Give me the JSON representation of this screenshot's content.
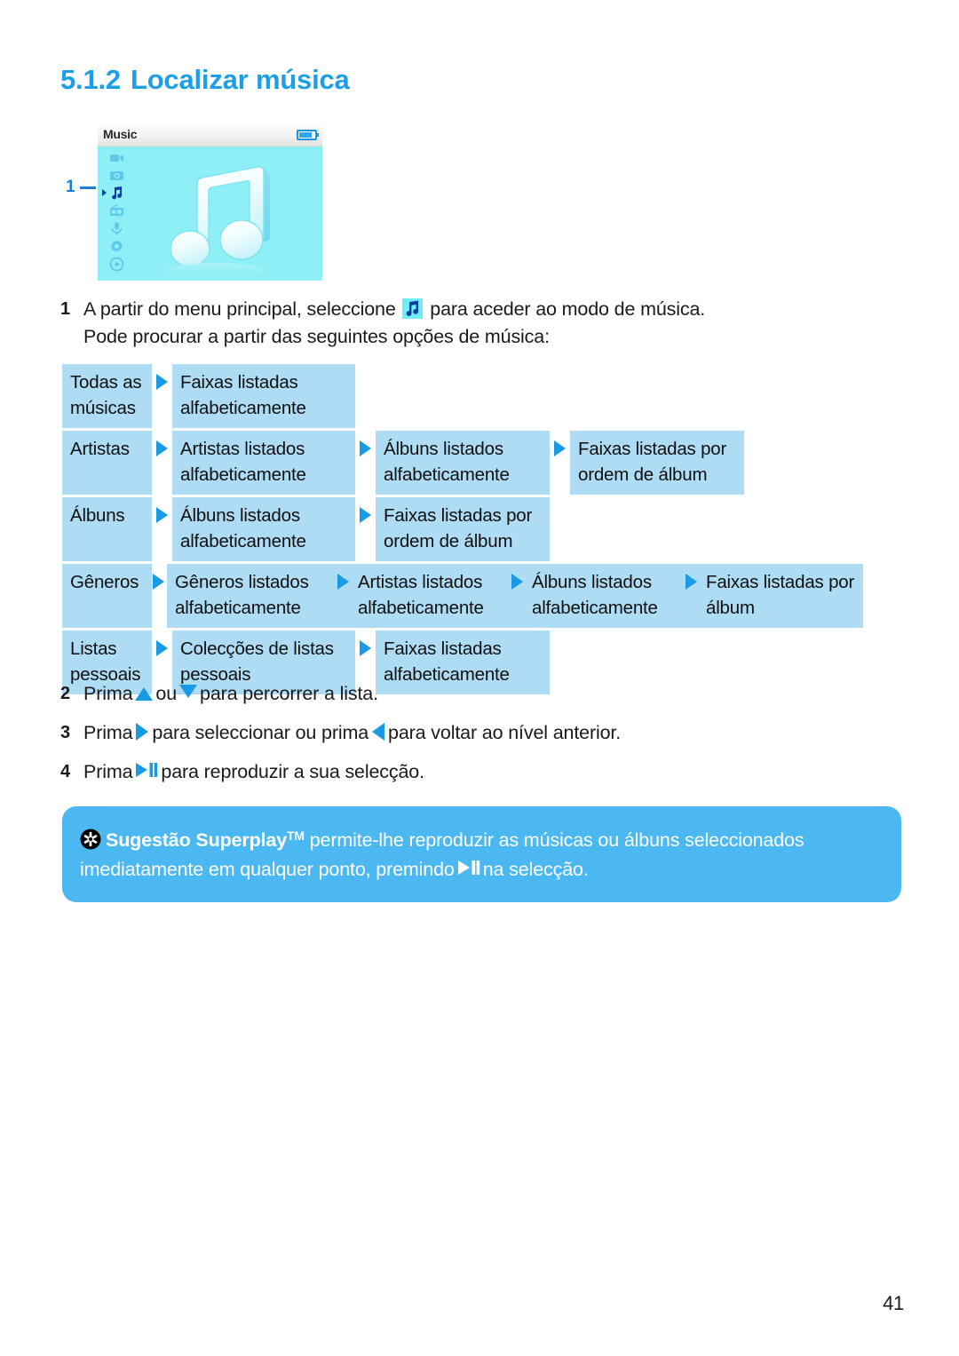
{
  "heading": {
    "number": "5.1.2",
    "title": "Localizar música"
  },
  "device": {
    "title": "Music",
    "battery_icon": "battery-icon",
    "sidebar_icons": [
      "video-camera-icon",
      "photo-camera-icon",
      "music-note-icon",
      "radio-icon",
      "microphone-icon",
      "settings-gear-icon",
      "play-circle-icon"
    ],
    "selected_index": 2,
    "main_icon": "music-note-3d-icon",
    "callout_number": "1"
  },
  "steps": [
    {
      "number": "1",
      "text_before": "A partir do menu principal, seleccione",
      "icon": "music-note-icon",
      "text_after": "para aceder ao modo de música.",
      "line2": "Pode procurar a partir das seguintes opções de música:"
    },
    {
      "number": "2",
      "part1": "Prima",
      "icon1": "arrow-up-icon",
      "part2": "ou",
      "icon2": "arrow-down-icon",
      "part3": "para percorrer a lista."
    },
    {
      "number": "3",
      "part1": "Prima",
      "icon1": "arrow-right-icon",
      "part2": "para seleccionar ou prima",
      "icon2": "arrow-left-icon",
      "part3": "para voltar ao nível anterior."
    },
    {
      "number": "4",
      "part1": "Prima",
      "icon1": "play-pause-icon",
      "part2": "para reproduzir a sua selecção."
    }
  ],
  "flow": {
    "rows": [
      {
        "cells": [
          "Todas as músicas",
          "Faixas listadas alfabeticamente"
        ]
      },
      {
        "cells": [
          "Artistas",
          "Artistas listados alfabeticamente",
          "Álbuns listados alfabeticamente",
          "Faixas listadas por ordem de álbum"
        ]
      },
      {
        "cells": [
          "Álbuns",
          "Álbuns listados alfabeticamente",
          "Faixas listadas por ordem de álbum"
        ]
      },
      {
        "cells": [
          "Gêneros",
          "Gêneros listados alfabeticamente",
          "Artistas listados alfabeticamente",
          "Álbuns listados alfabeticamente",
          "Faixas listadas por álbum"
        ]
      },
      {
        "cells": [
          "Listas pessoais",
          "Colecções de listas pessoais",
          "Faixas listadas alfabeticamente"
        ]
      }
    ]
  },
  "tip": {
    "icon": "asterisk-star-icon",
    "label": "Sugestão Superplay",
    "tm": "TM",
    "text_after_label": "permite-lhe reproduzir as músicas ou álbuns seleccionados imediatamente em qualquer ponto, premindo",
    "inline_icon": "play-pause-icon",
    "text_end": "na selecção."
  },
  "page_number": "41",
  "colors": {
    "heading_blue": "#1b9fe9",
    "cell_blue": "#aedcf4",
    "arrow_blue": "#189ae4",
    "tip_blue": "#4cb8f2",
    "screen_cyan": "#8ef0f6"
  }
}
